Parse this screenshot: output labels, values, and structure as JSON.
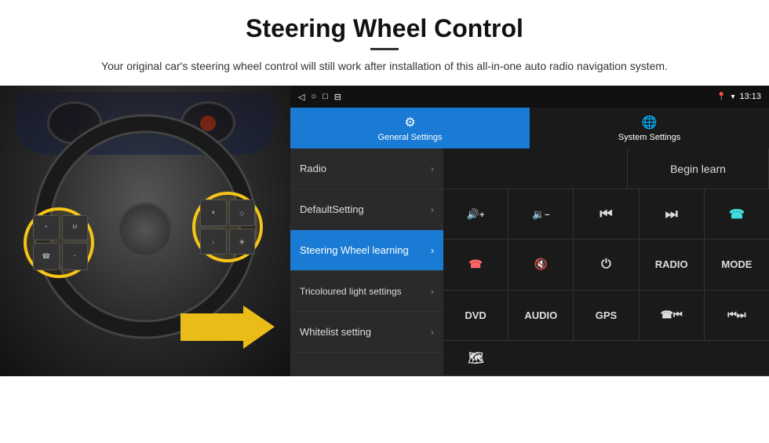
{
  "header": {
    "title": "Steering Wheel Control",
    "subtitle": "Your original car's steering wheel control will still work after installation of this all-in-one auto radio navigation system."
  },
  "statusBar": {
    "time": "13:13",
    "icons": [
      "◁",
      "○",
      "□",
      "⊟"
    ]
  },
  "tabs": [
    {
      "label": "General Settings",
      "icon": "⚙",
      "active": true
    },
    {
      "label": "System Settings",
      "icon": "🌐",
      "active": false
    }
  ],
  "menu": [
    {
      "label": "Radio",
      "active": false
    },
    {
      "label": "DefaultSetting",
      "active": false
    },
    {
      "label": "Steering Wheel learning",
      "active": true
    },
    {
      "label": "Tricoloured light settings",
      "active": false
    },
    {
      "label": "Whitelist setting",
      "active": false
    }
  ],
  "controls": {
    "beginLearn": "Begin learn",
    "row1": [
      "🔊+",
      "🔉−",
      "⏮",
      "⏭",
      "📞"
    ],
    "row1_symbols": [
      "+",
      "−",
      "⏮",
      "⏭",
      "✆"
    ],
    "row2": [
      "☎",
      "🔇",
      "⏻",
      "RADIO",
      "MODE"
    ],
    "row3": [
      "DVD",
      "AUDIO",
      "GPS",
      "✆⏮",
      "⏮⏭"
    ],
    "row4": [
      "🗺"
    ]
  }
}
